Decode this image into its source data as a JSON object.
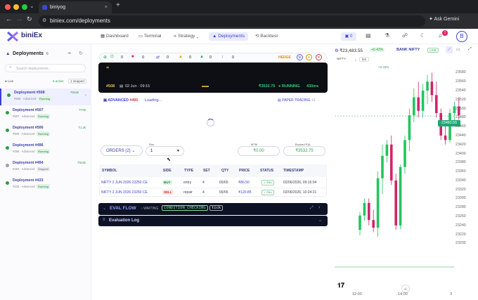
{
  "browser": {
    "tab_title": "biniyog",
    "url": "biniex.com/deployments",
    "ask_label": "Ask Gemini"
  },
  "nav": {
    "logo": "biniEx",
    "items": [
      "Dashboard",
      "Terminal",
      "Strategy",
      "Deployments",
      "Backtest"
    ],
    "active": "Deployments",
    "counter_badge": "0",
    "notification_count": "1",
    "avatar": "B"
  },
  "sidebar": {
    "title": "Deployments",
    "count": "6",
    "search_placeholder": "Search deployments...",
    "live_label": "Live",
    "active_label": "6 active",
    "stopped_label": "1 stopped",
    "items": [
      {
        "title": "Deployment #508",
        "sub": "#508 · Advanced",
        "status": "Running",
        "pnl": "₹553k"
      },
      {
        "title": "Deployment #507",
        "sub": "#507 · Advanced",
        "status": "Running",
        "pnl": "₹798"
      },
      {
        "title": "Deployment #506",
        "sub": "#506 · Advanced",
        "status": "Running",
        "pnl": "₹1.2k"
      },
      {
        "title": "Deployment #496",
        "sub": "#496 · Advanced",
        "status": "Running",
        "pnl": ""
      },
      {
        "title": "Deployment #494",
        "sub": "#494 · Advanced",
        "status": "Stopped",
        "pnl": "₹622k"
      },
      {
        "title": "Deployment #433",
        "sub": "#433 · Advanced",
        "status": "Running",
        "pnl": ""
      }
    ]
  },
  "statusbar": {
    "counts": [
      "0",
      "0",
      "0",
      "0",
      "0",
      "0"
    ],
    "hedge_label": "HEDGE"
  },
  "deployment": {
    "id_tag": "#508",
    "date": "02 Jun · 09:15",
    "pnl": "₹3532.75",
    "status": "RUNNING",
    "latency": "430ms",
    "quote_mark": "“"
  },
  "detail": {
    "mode": "ADVANCED",
    "mode_id": "#495",
    "loading": "Loading...",
    "paper_label": "PAPER TRADING",
    "paper_suffix": "+1",
    "orders_button": "ORDERS (2)",
    "run_label": "Run",
    "run_value": "1",
    "mtm_label": "MTM",
    "mtm_value": "₹0.00",
    "booked_label": "Booked P&L",
    "booked_value": "₹3532.75"
  },
  "orders": {
    "columns": [
      "SYMBOL",
      "SIDE",
      "TYPE",
      "SET",
      "QTY",
      "PRICE",
      "STATUS",
      "TIMESTAMP"
    ],
    "rows": [
      {
        "symbol": "NIFTY 2 JUN 2026 23250 CE",
        "side": "BUY",
        "type": "entry",
        "set": "4",
        "qty": "65/65",
        "price": "₹86.50",
        "status": "FILL",
        "time": "02/06/2026, 09:16:04"
      },
      {
        "symbol": "NIFTY 2 JUN 2026 23250 CE",
        "side": "SELL",
        "type": "repair",
        "set": "4",
        "qty": "65/65",
        "price": "₹120.85",
        "status": "FILL",
        "time": "02/06/2026, 10:24:21"
      }
    ]
  },
  "evalflow": {
    "title": "EVAL FLOW",
    "state": "WAITING",
    "chip1": "CONDITION_CHECKING",
    "chip2": "tick",
    "log_title": "Evaluation Log"
  },
  "chart_data": {
    "type": "candlestick",
    "instrument": "NIFTY",
    "interval": "5m",
    "top_price": "₹23,483.55",
    "top_change": "+0.43%",
    "bank_label": "BANK NIFTY",
    "live_tag": "LIVE",
    "sub_change": "+0.43%",
    "last_price_label": "23483.55",
    "y_ticks": [
      23580,
      23560,
      23540,
      23520,
      23500,
      23480,
      23460,
      23440,
      23420,
      23400,
      23380,
      23360,
      23340,
      23320,
      23300,
      23280,
      23260,
      23240,
      23220,
      23200
    ],
    "x_ticks": [
      "12:00",
      "14:00",
      "3"
    ],
    "ylim": [
      23196,
      23590
    ],
    "last_price": 23483.55,
    "candles": [
      {
        "o": 23230,
        "h": 23270,
        "l": 23218,
        "c": 23262
      },
      {
        "o": 23262,
        "h": 23300,
        "l": 23250,
        "c": 23290
      },
      {
        "o": 23290,
        "h": 23300,
        "l": 23240,
        "c": 23252
      },
      {
        "o": 23252,
        "h": 23275,
        "l": 23225,
        "c": 23235
      },
      {
        "o": 23235,
        "h": 23360,
        "l": 23215,
        "c": 23345
      },
      {
        "o": 23345,
        "h": 23420,
        "l": 23310,
        "c": 23395
      },
      {
        "o": 23395,
        "h": 23430,
        "l": 23380,
        "c": 23420
      },
      {
        "o": 23420,
        "h": 23440,
        "l": 23330,
        "c": 23340
      },
      {
        "o": 23340,
        "h": 23355,
        "l": 23230,
        "c": 23240
      },
      {
        "o": 23240,
        "h": 23375,
        "l": 23232,
        "c": 23370
      },
      {
        "o": 23370,
        "h": 23440,
        "l": 23355,
        "c": 23430
      },
      {
        "o": 23430,
        "h": 23500,
        "l": 23405,
        "c": 23485
      },
      {
        "o": 23485,
        "h": 23545,
        "l": 23470,
        "c": 23525
      },
      {
        "o": 23525,
        "h": 23560,
        "l": 23480,
        "c": 23495
      },
      {
        "o": 23495,
        "h": 23555,
        "l": 23480,
        "c": 23540
      },
      {
        "o": 23540,
        "h": 23575,
        "l": 23510,
        "c": 23560
      },
      {
        "o": 23560,
        "h": 23580,
        "l": 23515,
        "c": 23530
      },
      {
        "o": 23530,
        "h": 23560,
        "l": 23480,
        "c": 23490
      },
      {
        "o": 23490,
        "h": 23500,
        "l": 23430,
        "c": 23440
      },
      {
        "o": 23440,
        "h": 23460,
        "l": 23420,
        "c": 23430
      },
      {
        "o": 23430,
        "h": 23500,
        "l": 23425,
        "c": 23490
      },
      {
        "o": 23490,
        "h": 23515,
        "l": 23470,
        "c": 23505
      },
      {
        "o": 23505,
        "h": 23525,
        "l": 23475,
        "c": 23485
      }
    ]
  }
}
